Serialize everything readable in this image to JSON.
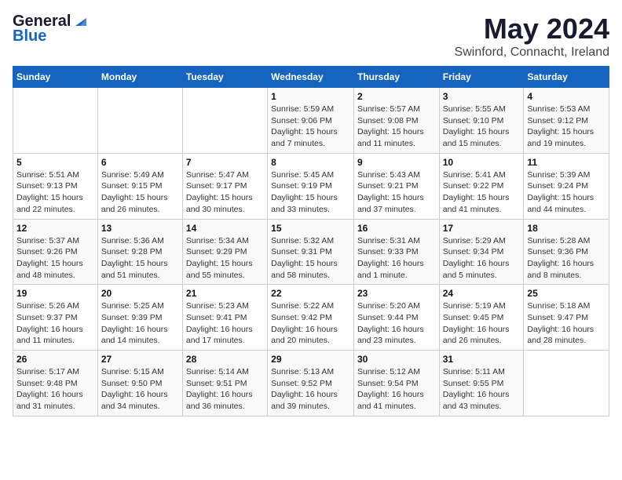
{
  "logo": {
    "line1": "General",
    "line2": "Blue"
  },
  "header": {
    "month": "May 2024",
    "location": "Swinford, Connacht, Ireland"
  },
  "weekdays": [
    "Sunday",
    "Monday",
    "Tuesday",
    "Wednesday",
    "Thursday",
    "Friday",
    "Saturday"
  ],
  "weeks": [
    [
      {
        "day": "",
        "detail": ""
      },
      {
        "day": "",
        "detail": ""
      },
      {
        "day": "",
        "detail": ""
      },
      {
        "day": "1",
        "detail": "Sunrise: 5:59 AM\nSunset: 9:06 PM\nDaylight: 15 hours\nand 7 minutes."
      },
      {
        "day": "2",
        "detail": "Sunrise: 5:57 AM\nSunset: 9:08 PM\nDaylight: 15 hours\nand 11 minutes."
      },
      {
        "day": "3",
        "detail": "Sunrise: 5:55 AM\nSunset: 9:10 PM\nDaylight: 15 hours\nand 15 minutes."
      },
      {
        "day": "4",
        "detail": "Sunrise: 5:53 AM\nSunset: 9:12 PM\nDaylight: 15 hours\nand 19 minutes."
      }
    ],
    [
      {
        "day": "5",
        "detail": "Sunrise: 5:51 AM\nSunset: 9:13 PM\nDaylight: 15 hours\nand 22 minutes."
      },
      {
        "day": "6",
        "detail": "Sunrise: 5:49 AM\nSunset: 9:15 PM\nDaylight: 15 hours\nand 26 minutes."
      },
      {
        "day": "7",
        "detail": "Sunrise: 5:47 AM\nSunset: 9:17 PM\nDaylight: 15 hours\nand 30 minutes."
      },
      {
        "day": "8",
        "detail": "Sunrise: 5:45 AM\nSunset: 9:19 PM\nDaylight: 15 hours\nand 33 minutes."
      },
      {
        "day": "9",
        "detail": "Sunrise: 5:43 AM\nSunset: 9:21 PM\nDaylight: 15 hours\nand 37 minutes."
      },
      {
        "day": "10",
        "detail": "Sunrise: 5:41 AM\nSunset: 9:22 PM\nDaylight: 15 hours\nand 41 minutes."
      },
      {
        "day": "11",
        "detail": "Sunrise: 5:39 AM\nSunset: 9:24 PM\nDaylight: 15 hours\nand 44 minutes."
      }
    ],
    [
      {
        "day": "12",
        "detail": "Sunrise: 5:37 AM\nSunset: 9:26 PM\nDaylight: 15 hours\nand 48 minutes."
      },
      {
        "day": "13",
        "detail": "Sunrise: 5:36 AM\nSunset: 9:28 PM\nDaylight: 15 hours\nand 51 minutes."
      },
      {
        "day": "14",
        "detail": "Sunrise: 5:34 AM\nSunset: 9:29 PM\nDaylight: 15 hours\nand 55 minutes."
      },
      {
        "day": "15",
        "detail": "Sunrise: 5:32 AM\nSunset: 9:31 PM\nDaylight: 15 hours\nand 58 minutes."
      },
      {
        "day": "16",
        "detail": "Sunrise: 5:31 AM\nSunset: 9:33 PM\nDaylight: 16 hours\nand 1 minute."
      },
      {
        "day": "17",
        "detail": "Sunrise: 5:29 AM\nSunset: 9:34 PM\nDaylight: 16 hours\nand 5 minutes."
      },
      {
        "day": "18",
        "detail": "Sunrise: 5:28 AM\nSunset: 9:36 PM\nDaylight: 16 hours\nand 8 minutes."
      }
    ],
    [
      {
        "day": "19",
        "detail": "Sunrise: 5:26 AM\nSunset: 9:37 PM\nDaylight: 16 hours\nand 11 minutes."
      },
      {
        "day": "20",
        "detail": "Sunrise: 5:25 AM\nSunset: 9:39 PM\nDaylight: 16 hours\nand 14 minutes."
      },
      {
        "day": "21",
        "detail": "Sunrise: 5:23 AM\nSunset: 9:41 PM\nDaylight: 16 hours\nand 17 minutes."
      },
      {
        "day": "22",
        "detail": "Sunrise: 5:22 AM\nSunset: 9:42 PM\nDaylight: 16 hours\nand 20 minutes."
      },
      {
        "day": "23",
        "detail": "Sunrise: 5:20 AM\nSunset: 9:44 PM\nDaylight: 16 hours\nand 23 minutes."
      },
      {
        "day": "24",
        "detail": "Sunrise: 5:19 AM\nSunset: 9:45 PM\nDaylight: 16 hours\nand 26 minutes."
      },
      {
        "day": "25",
        "detail": "Sunrise: 5:18 AM\nSunset: 9:47 PM\nDaylight: 16 hours\nand 28 minutes."
      }
    ],
    [
      {
        "day": "26",
        "detail": "Sunrise: 5:17 AM\nSunset: 9:48 PM\nDaylight: 16 hours\nand 31 minutes."
      },
      {
        "day": "27",
        "detail": "Sunrise: 5:15 AM\nSunset: 9:50 PM\nDaylight: 16 hours\nand 34 minutes."
      },
      {
        "day": "28",
        "detail": "Sunrise: 5:14 AM\nSunset: 9:51 PM\nDaylight: 16 hours\nand 36 minutes."
      },
      {
        "day": "29",
        "detail": "Sunrise: 5:13 AM\nSunset: 9:52 PM\nDaylight: 16 hours\nand 39 minutes."
      },
      {
        "day": "30",
        "detail": "Sunrise: 5:12 AM\nSunset: 9:54 PM\nDaylight: 16 hours\nand 41 minutes."
      },
      {
        "day": "31",
        "detail": "Sunrise: 5:11 AM\nSunset: 9:55 PM\nDaylight: 16 hours\nand 43 minutes."
      },
      {
        "day": "",
        "detail": ""
      }
    ]
  ]
}
